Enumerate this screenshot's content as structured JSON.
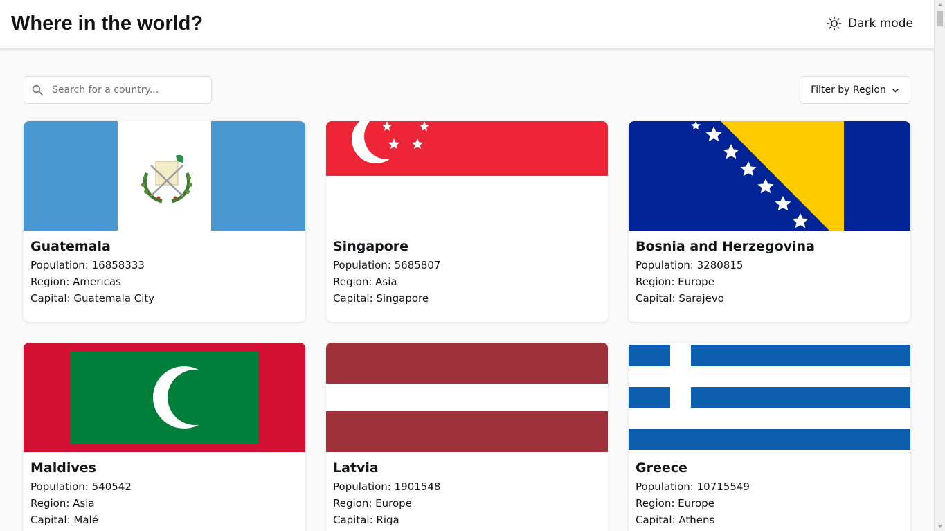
{
  "header": {
    "title": "Where in the world?",
    "theme_toggle_label": "Dark mode",
    "theme_icon": "sun-icon"
  },
  "search": {
    "placeholder": "Search for a country...",
    "value": "",
    "icon": "search-icon"
  },
  "filter": {
    "label": "Filter by Region",
    "icon": "chevron-down-icon"
  },
  "countries": [
    {
      "name": "Guatemala",
      "population": "Population: 16858333",
      "region": "Region: Americas",
      "capital": "Capital: Guatemala City",
      "flag": "guatemala-flag"
    },
    {
      "name": "Singapore",
      "population": "Population: 5685807",
      "region": "Region: Asia",
      "capital": "Capital: Singapore",
      "flag": "singapore-flag"
    },
    {
      "name": "Bosnia and Herzegovina",
      "population": "Population: 3280815",
      "region": "Region: Europe",
      "capital": "Capital: Sarajevo",
      "flag": "bosnia-flag"
    },
    {
      "name": "Maldives",
      "population": "Population: 540542",
      "region": "Region: Asia",
      "capital": "Capital: Malé",
      "flag": "maldives-flag"
    },
    {
      "name": "Latvia",
      "population": "Population: 1901548",
      "region": "Region: Europe",
      "capital": "Capital: Riga",
      "flag": "latvia-flag"
    },
    {
      "name": "Greece",
      "population": "Population: 10715549",
      "region": "Region: Europe",
      "capital": "Capital: Athens",
      "flag": "greece-flag"
    }
  ],
  "colors": {
    "background": "#fafafa",
    "surface": "#ffffff",
    "text": "#111517"
  }
}
